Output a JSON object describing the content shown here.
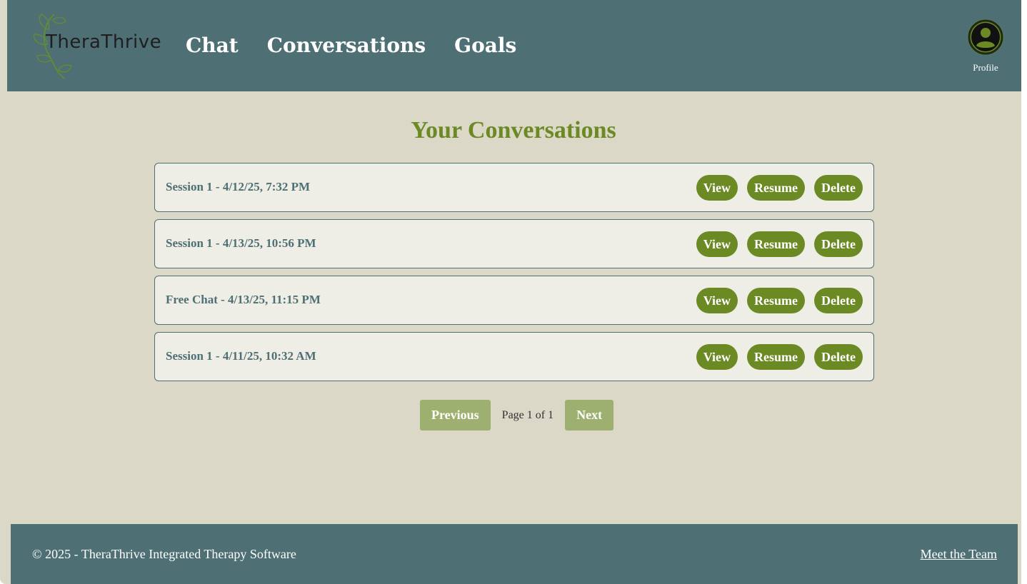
{
  "brand": {
    "name": "TheraThrive",
    "logo_icon": "vine-leaf-logo"
  },
  "nav": {
    "items": [
      {
        "label": "Chat"
      },
      {
        "label": "Conversations"
      },
      {
        "label": "Goals"
      }
    ]
  },
  "profile": {
    "label": "Profile",
    "icon": "user-circle-icon"
  },
  "main": {
    "title": "Your Conversations",
    "conversations": [
      {
        "title": "Session 1 - 4/12/25, 7:32 PM"
      },
      {
        "title": "Session 1 - 4/13/25, 10:56 PM"
      },
      {
        "title": "Free Chat - 4/13/25, 11:15 PM"
      },
      {
        "title": "Session 1 - 4/11/25, 10:32 AM"
      }
    ],
    "actions": {
      "view": "View",
      "resume": "Resume",
      "delete": "Delete"
    }
  },
  "pagination": {
    "previous": "Previous",
    "info": "Page 1 of 1",
    "next": "Next"
  },
  "footer": {
    "copyright": "© 2025 - TheraThrive Integrated Therapy Software",
    "team_link": "Meet the Team"
  },
  "colors": {
    "header_bg": "#4e6f74",
    "page_bg": "#dbd8c8",
    "accent": "#6b8a24",
    "accent_disabled": "#9db070",
    "card_bg": "#eeede6"
  }
}
